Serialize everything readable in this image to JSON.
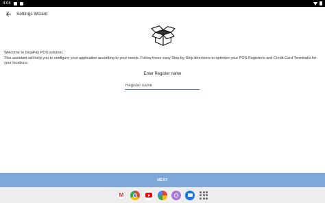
{
  "status_bar": {
    "time": "4:04"
  },
  "app_bar": {
    "title": "Settings Wizard"
  },
  "intro": {
    "line1": "Welcome to DejaPay POS solution.",
    "line2": "This assistant will help you to configure your application according to your needs. Follow these easy Step by Step directions to optimize your POS Register/s and Credit Card Terminal/s for your locations."
  },
  "register": {
    "label": "Enter Register name",
    "placeholder": "Register name",
    "value": ""
  },
  "next_button": {
    "label": "NEXT"
  },
  "taskbar": {
    "apps": [
      "gmail-icon",
      "chrome-icon",
      "youtube-icon",
      "photos-icon",
      "podcasts-icon",
      "messages-icon",
      "app-drawer-icon"
    ]
  }
}
